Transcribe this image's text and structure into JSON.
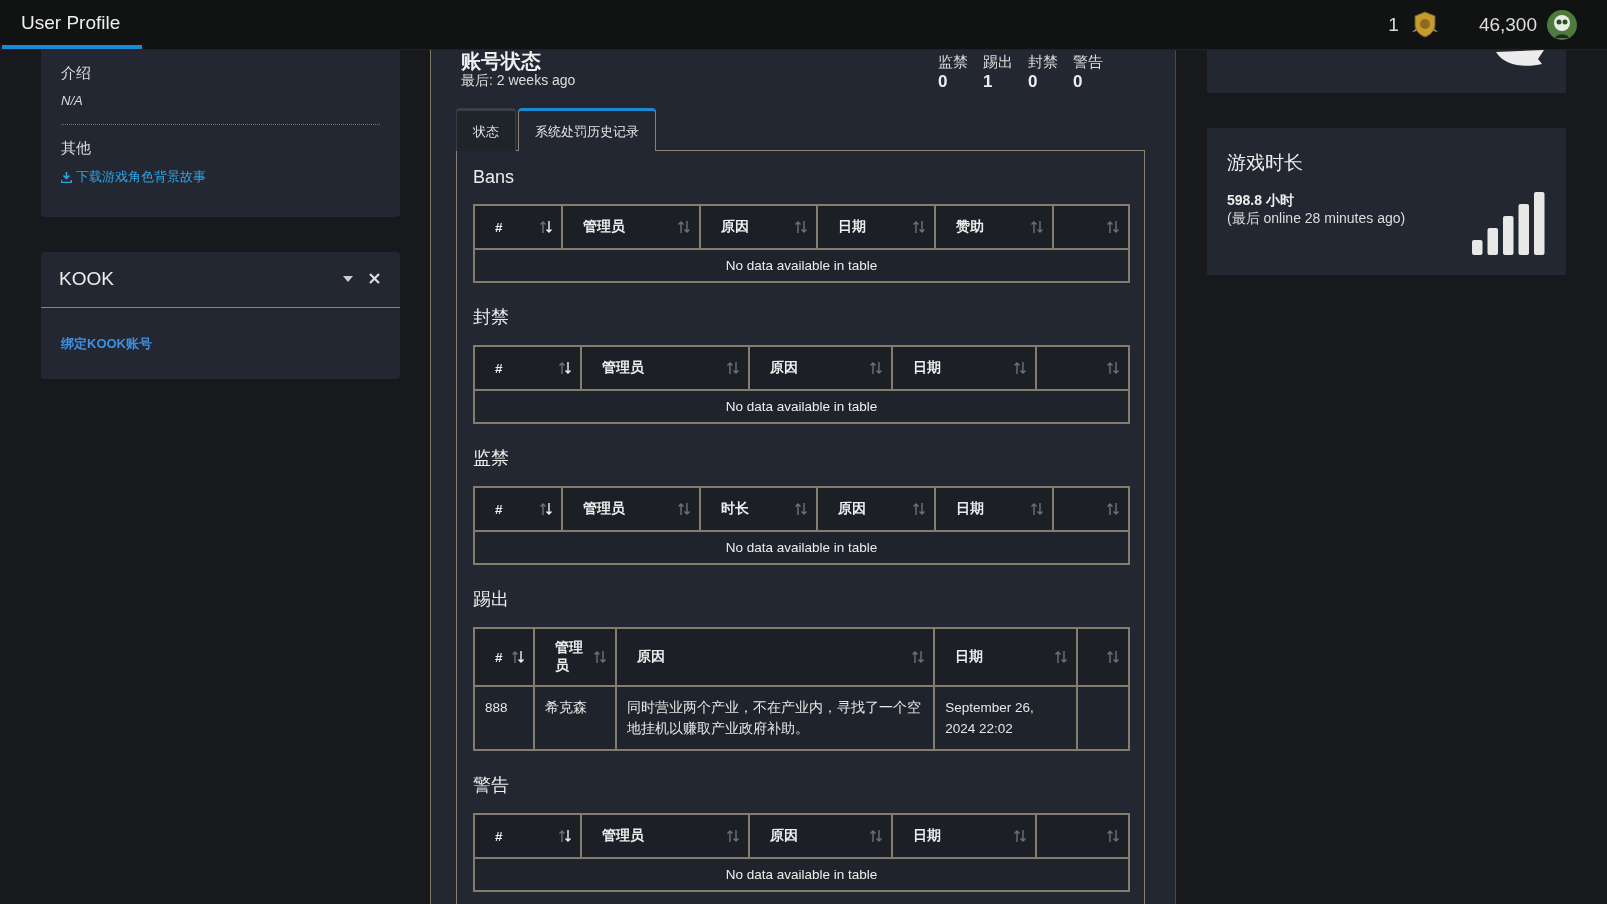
{
  "navbar": {
    "tabs": [
      {
        "label": "User Profile",
        "selected": true
      }
    ],
    "badge_count": "1",
    "points": "46,300"
  },
  "about": {
    "intro_label": "介绍",
    "intro_value": "N/A",
    "other_label": "其他",
    "download_link": "下载游戏角色背景故事"
  },
  "kook": {
    "title": "KOOK",
    "link": "绑定KOOK账号"
  },
  "account": {
    "title": "账号状态",
    "last": "最后: 2 weeks ago",
    "counters": [
      {
        "label": "监禁",
        "value": "0"
      },
      {
        "label": "踢出",
        "value": "1"
      },
      {
        "label": "封禁",
        "value": "0"
      },
      {
        "label": "警告",
        "value": "0"
      }
    ],
    "tabs": [
      {
        "label": "状态",
        "selected": false
      },
      {
        "label": "系统处罚历史记录",
        "selected": true
      }
    ],
    "sections": [
      {
        "title": "Bans",
        "columns": [
          {
            "label": "#",
            "sorted": true
          },
          {
            "label": "管理员",
            "sorted": false
          },
          {
            "label": "原因",
            "sorted": false
          },
          {
            "label": "日期",
            "sorted": false
          },
          {
            "label": "赞助",
            "sorted": false
          },
          {
            "sorted": false
          }
        ],
        "empty": "No data available in table"
      },
      {
        "title": "封禁",
        "columns": [
          {
            "label": "#",
            "sorted": true
          },
          {
            "label": "管理员",
            "sorted": false
          },
          {
            "label": "原因",
            "sorted": false
          },
          {
            "label": "日期",
            "sorted": false
          },
          {
            "sorted": false
          }
        ],
        "empty": "No data available in table"
      },
      {
        "title": "监禁",
        "columns": [
          {
            "label": "#",
            "sorted": true
          },
          {
            "label": "管理员",
            "sorted": false
          },
          {
            "label": "时长",
            "sorted": false
          },
          {
            "label": "原因",
            "sorted": false
          },
          {
            "label": "日期",
            "sorted": false
          },
          {
            "sorted": false
          }
        ],
        "empty": "No data available in table"
      },
      {
        "title": "踢出",
        "columns": [
          {
            "label": "#",
            "sorted": true
          },
          {
            "label": "管理员",
            "sorted": false
          },
          {
            "label": "原因",
            "sorted": false
          },
          {
            "label": "日期",
            "sorted": false
          },
          {
            "sorted": false
          }
        ],
        "rows": [
          [
            "888",
            "希克森",
            "同时营业两个产业，不在产业内，寻找了一个空地挂机以赚取产业政府补助。",
            "September 26, 2024 22:02",
            ""
          ]
        ]
      },
      {
        "title": "警告",
        "columns": [
          {
            "label": "#",
            "sorted": true
          },
          {
            "label": "管理员",
            "sorted": false
          },
          {
            "label": "原因",
            "sorted": false
          },
          {
            "label": "日期",
            "sorted": false
          },
          {
            "sorted": false
          }
        ],
        "empty": "No data available in table"
      }
    ]
  },
  "playtime": {
    "title": "游戏时长",
    "hours": "598.8 小时",
    "last_online": "(最后 online 28 minutes ago)"
  }
}
